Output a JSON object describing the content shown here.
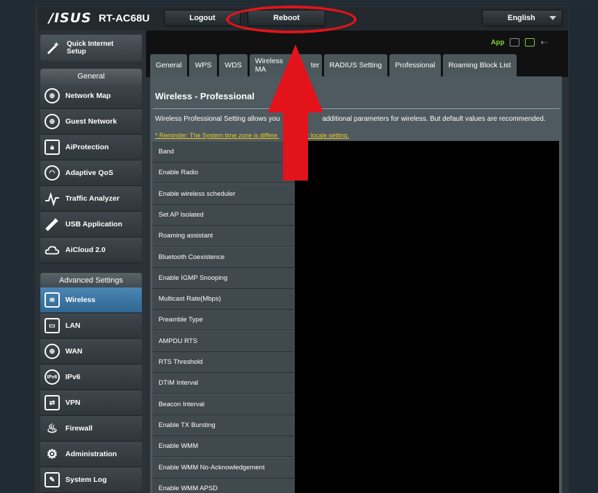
{
  "header": {
    "brand": "/ISUS",
    "model": "RT-AC68U",
    "logout_label": "Logout",
    "reboot_label": "Reboot",
    "language_label": "English"
  },
  "sidebar": {
    "quick_setup_label": "Quick Internet\nSetup",
    "general_heading": "General",
    "general_items": [
      {
        "label": "Network Map",
        "icon": "globe-icon"
      },
      {
        "label": "Guest Network",
        "icon": "globe-icon"
      },
      {
        "label": "AiProtection",
        "icon": "lock-icon"
      },
      {
        "label": "Adaptive QoS",
        "icon": "gauge-icon"
      },
      {
        "label": "Traffic Analyzer",
        "icon": "chart-icon"
      },
      {
        "label": "USB Application",
        "icon": "usb-icon"
      },
      {
        "label": "AiCloud 2.0",
        "icon": "cloud-icon"
      }
    ],
    "advanced_heading": "Advanced Settings",
    "advanced_items": [
      {
        "label": "Wireless",
        "icon": "wifi-icon",
        "active": true
      },
      {
        "label": "LAN",
        "icon": "lan-icon"
      },
      {
        "label": "WAN",
        "icon": "globe-icon"
      },
      {
        "label": "IPv6",
        "icon": "ipv6-icon"
      },
      {
        "label": "VPN",
        "icon": "vpn-icon"
      },
      {
        "label": "Firewall",
        "icon": "fire-icon"
      },
      {
        "label": "Administration",
        "icon": "gear-icon"
      },
      {
        "label": "System Log",
        "icon": "log-icon"
      }
    ]
  },
  "toolbar": {
    "app_label": "App"
  },
  "tabs": [
    {
      "label": "General"
    },
    {
      "label": "WPS"
    },
    {
      "label": "WDS"
    },
    {
      "label": "Wireless MA",
      "tail": "ter"
    },
    {
      "label": "RADIUS Setting"
    },
    {
      "label": "Professional",
      "active": true
    },
    {
      "label": "Roaming Block List"
    }
  ],
  "main": {
    "title": "Wireless - Professional",
    "description": "Wireless Professional Setting allows you",
    "description_tail": "additional parameters for wireless. But default values are recommended.",
    "reminder": "* Reminder: The System time zone is differe",
    "reminder_tail": "our locale setting.",
    "rows": [
      "Band",
      "Enable Radio",
      "Enable wireless scheduler",
      "Set AP Isolated",
      "Roaming assistant",
      "Bluetooth Coexistence",
      "Enable IGMP Snooping",
      "Multicast Rate(Mbps)",
      "Preamble Type",
      "AMPDU RTS",
      "RTS Threshold",
      "DTIM Interval",
      "Beacon Interval",
      "Enable TX Bursting",
      "Enable WMM",
      "Enable WMM No-Acknowledgement",
      "Enable WMM APSD"
    ]
  },
  "colors": {
    "annotation_red": "#e3131b",
    "accent_green": "#84d43b",
    "reminder_yellow": "#f0c92c",
    "active_blue": "#3f7aa6"
  }
}
